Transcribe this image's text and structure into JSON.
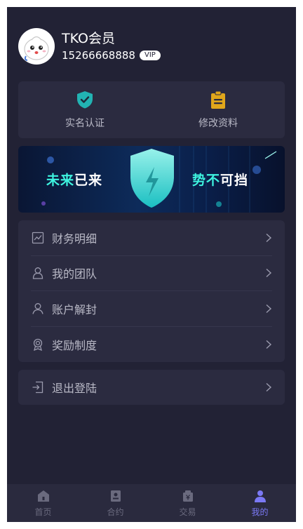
{
  "profile": {
    "username": "TKO会员",
    "phone": "15266668888",
    "badge": "VIP"
  },
  "actions": [
    {
      "label": "实名认证",
      "icon": "shield-check-icon",
      "color": "#22b3b3"
    },
    {
      "label": "修改资料",
      "icon": "clipboard-icon",
      "color": "#e0a61b"
    }
  ],
  "banner": {
    "left_highlight": "未来",
    "left_plain": "已来",
    "right_highlight": "势不",
    "right_plain": "可挡"
  },
  "menu": [
    {
      "label": "财务明细",
      "icon": "chart-icon"
    },
    {
      "label": "我的团队",
      "icon": "team-icon"
    },
    {
      "label": "账户解封",
      "icon": "user-icon"
    },
    {
      "label": "奖励制度",
      "icon": "award-icon"
    }
  ],
  "logout": {
    "label": "退出登陆",
    "icon": "logout-icon"
  },
  "tabs": [
    {
      "label": "首页",
      "icon": "home-icon",
      "active": false
    },
    {
      "label": "合约",
      "icon": "contract-icon",
      "active": false
    },
    {
      "label": "交易",
      "icon": "trade-icon",
      "active": false
    },
    {
      "label": "我的",
      "icon": "profile-icon",
      "active": true
    }
  ],
  "colors": {
    "background": "#222235",
    "card": "#2b2b40",
    "accent": "#7b79f5",
    "banner_highlight": "#3ef3df"
  }
}
